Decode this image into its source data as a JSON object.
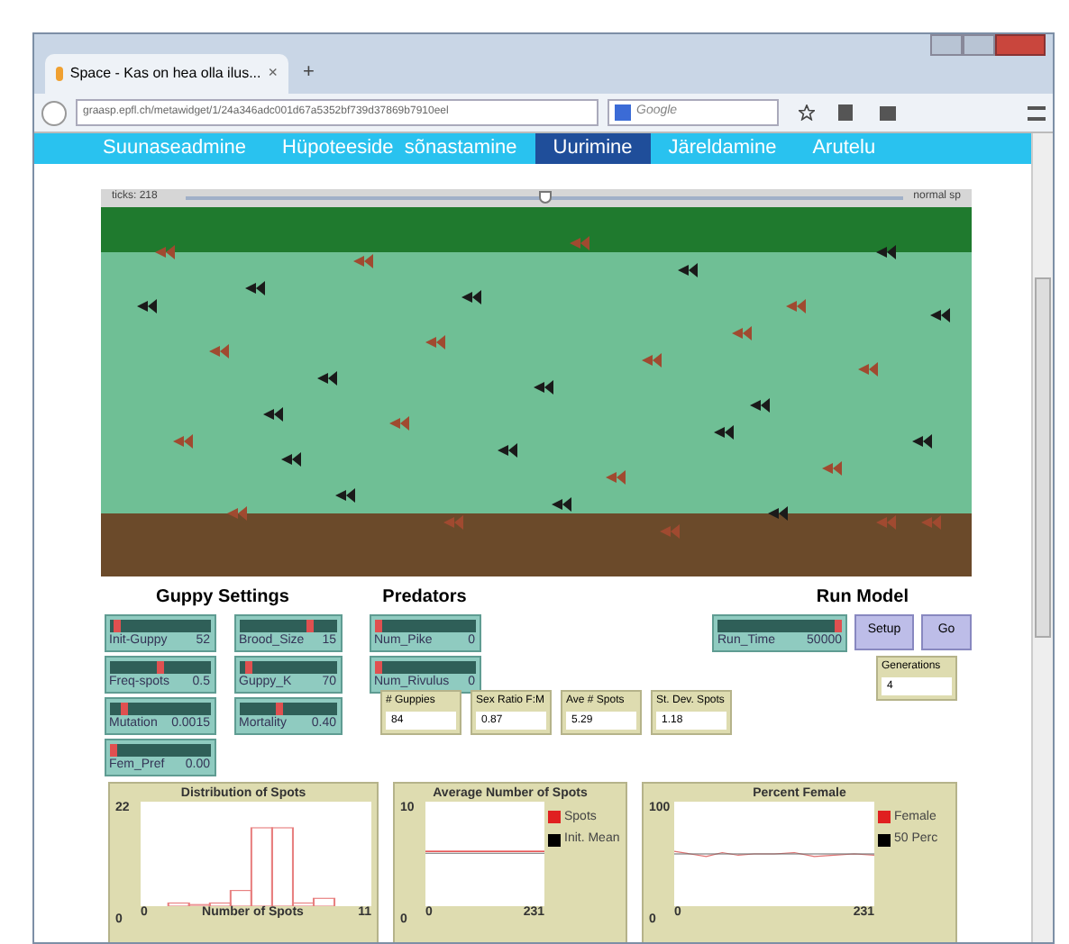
{
  "browser": {
    "tab_title": "Space - Kas on hea olla ilus...",
    "tab_close": "×",
    "new_tab": "+",
    "url": "graasp.epfl.ch/metawidget/1/24a346adc001d67a5352bf739d37869b7910eel",
    "search_placeholder": "Google"
  },
  "nav": [
    {
      "label": "Suunaseadmine",
      "selected": false
    },
    {
      "label": "Hüpoteeside  sõnastamine",
      "selected": false
    },
    {
      "label": "Uurimine",
      "selected": true
    },
    {
      "label": "Järeldamine",
      "selected": false
    },
    {
      "label": "Arutelu",
      "selected": false
    }
  ],
  "speed": {
    "ticks": "ticks: 218",
    "level": 0.5,
    "label": "normal sp"
  },
  "guppy_settings": {
    "title": "Guppy Settings",
    "sliders": [
      {
        "name": "Init-Guppy",
        "value": "52",
        "level": 0.05
      },
      {
        "name": "Freq-spots",
        "value": "0.5",
        "level": 0.5
      },
      {
        "name": "Mutation",
        "value": "0.0015",
        "level": 0.12
      },
      {
        "name": "Fem_Pref",
        "value": "0.00",
        "level": 0.0
      },
      {
        "name": "Brood_Size",
        "value": "15",
        "level": 0.75
      },
      {
        "name": "Guppy_K",
        "value": "70",
        "level": 0.08
      },
      {
        "name": "Mortality",
        "value": "0.40",
        "level": 0.42
      }
    ]
  },
  "predators": {
    "title": "Predators",
    "sliders": [
      {
        "name": "Num_Pike",
        "value": "0",
        "level": 0.0
      },
      {
        "name": "Num_Rivulus",
        "value": "0",
        "level": 0.0
      }
    ]
  },
  "run_model": {
    "title": "Run Model",
    "slider": {
      "name": "Run_Time",
      "value": "50000",
      "level": 1.0
    },
    "buttons": [
      "Setup",
      "Go"
    ],
    "monitor": {
      "label": "Generations",
      "value": "4"
    }
  },
  "monitors": [
    {
      "label": "# Guppies",
      "value": "84"
    },
    {
      "label": "Sex Ratio F:M",
      "value": "0.87"
    },
    {
      "label": "Ave # Spots",
      "value": "5.29"
    },
    {
      "label": "St. Dev. Spots",
      "value": "1.18"
    }
  ],
  "plots": [
    {
      "kind": "histogram",
      "title": "Distribution of Spots",
      "ymax": "22",
      "ymin": "0",
      "xmin": "0",
      "xlabel": "Number of Spots",
      "xmax": "11"
    },
    {
      "kind": "line",
      "title": "Average Number of Spots",
      "ymax": "10",
      "ymin": "0",
      "xmin": "0",
      "xmax": "231",
      "legend": [
        {
          "label": "Spots",
          "color": "#e02020"
        },
        {
          "label": "Init. Mean",
          "color": "#000000"
        }
      ]
    },
    {
      "kind": "line2",
      "title": "Percent Female",
      "ymax": "100",
      "ymin": "0",
      "xmin": "0",
      "xmax": "231",
      "legend": [
        {
          "label": "Female",
          "color": "#e02020"
        },
        {
          "label": "50 Perc",
          "color": "#000000"
        }
      ]
    }
  ]
}
